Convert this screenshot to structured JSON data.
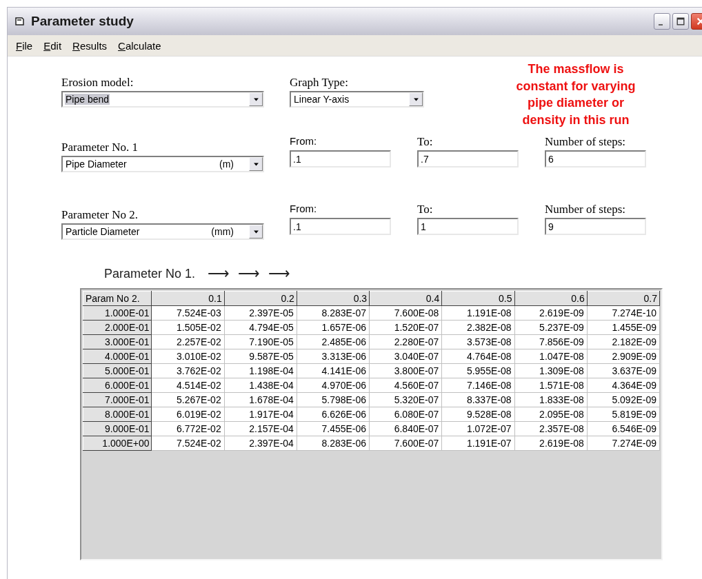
{
  "window": {
    "title": "Parameter study"
  },
  "menu": [
    {
      "label": "File"
    },
    {
      "label": "Edit"
    },
    {
      "label": "Results"
    },
    {
      "label": "Calculate"
    }
  ],
  "erosion_model": {
    "label": "Erosion model:",
    "value": "Pipe bend",
    "highlighted": true
  },
  "graph_type": {
    "label": "Graph Type:",
    "value": "Linear Y-axis",
    "highlighted": false
  },
  "note": {
    "lines": [
      "The massflow is",
      "constant for varying",
      "pipe diameter or",
      "density in this run"
    ]
  },
  "parameters": [
    {
      "label": "Parameter No. 1",
      "value": "Pipe Diameter",
      "unit": "(m)",
      "from_label": "From:",
      "from": ".1",
      "to_label": "To:",
      "to": ".7",
      "steps_label": "Number of steps:",
      "steps": "6"
    },
    {
      "label": "Parameter No 2.",
      "value": "Particle Diameter",
      "unit": "(mm)",
      "from_label": "From:",
      "from": ".1",
      "to_label": "To:",
      "to": "1",
      "steps_label": "Number of steps:",
      "steps": "9"
    }
  ],
  "axis_caption": {
    "text": "Parameter No 1.",
    "arrows": [
      "⟶",
      "⟶",
      "⟶"
    ]
  },
  "table": {
    "corner": "Param No 2.",
    "columns": [
      "0.1",
      "0.2",
      "0.3",
      "0.4",
      "0.5",
      "0.6",
      "0.7"
    ],
    "rows": [
      {
        "header": "1.000E-01",
        "cells": [
          "7.524E-03",
          "2.397E-05",
          "8.283E-07",
          "7.600E-08",
          "1.191E-08",
          "2.619E-09",
          "7.274E-10"
        ]
      },
      {
        "header": "2.000E-01",
        "cells": [
          "1.505E-02",
          "4.794E-05",
          "1.657E-06",
          "1.520E-07",
          "2.382E-08",
          "5.237E-09",
          "1.455E-09"
        ]
      },
      {
        "header": "3.000E-01",
        "cells": [
          "2.257E-02",
          "7.190E-05",
          "2.485E-06",
          "2.280E-07",
          "3.573E-08",
          "7.856E-09",
          "2.182E-09"
        ]
      },
      {
        "header": "4.000E-01",
        "cells": [
          "3.010E-02",
          "9.587E-05",
          "3.313E-06",
          "3.040E-07",
          "4.764E-08",
          "1.047E-08",
          "2.909E-09"
        ]
      },
      {
        "header": "5.000E-01",
        "cells": [
          "3.762E-02",
          "1.198E-04",
          "4.141E-06",
          "3.800E-07",
          "5.955E-08",
          "1.309E-08",
          "3.637E-09"
        ]
      },
      {
        "header": "6.000E-01",
        "cells": [
          "4.514E-02",
          "1.438E-04",
          "4.970E-06",
          "4.560E-07",
          "7.146E-08",
          "1.571E-08",
          "4.364E-09"
        ]
      },
      {
        "header": "7.000E-01",
        "cells": [
          "5.267E-02",
          "1.678E-04",
          "5.798E-06",
          "5.320E-07",
          "8.337E-08",
          "1.833E-08",
          "5.092E-09"
        ]
      },
      {
        "header": "8.000E-01",
        "cells": [
          "6.019E-02",
          "1.917E-04",
          "6.626E-06",
          "6.080E-07",
          "9.528E-08",
          "2.095E-08",
          "5.819E-09"
        ]
      },
      {
        "header": "9.000E-01",
        "cells": [
          "6.772E-02",
          "2.157E-04",
          "7.455E-06",
          "6.840E-07",
          "1.072E-07",
          "2.357E-08",
          "6.546E-09"
        ]
      },
      {
        "header": "1.000E+00",
        "cells": [
          "7.524E-02",
          "2.397E-04",
          "8.283E-06",
          "7.600E-07",
          "1.191E-07",
          "2.619E-08",
          "7.274E-09"
        ]
      }
    ]
  }
}
